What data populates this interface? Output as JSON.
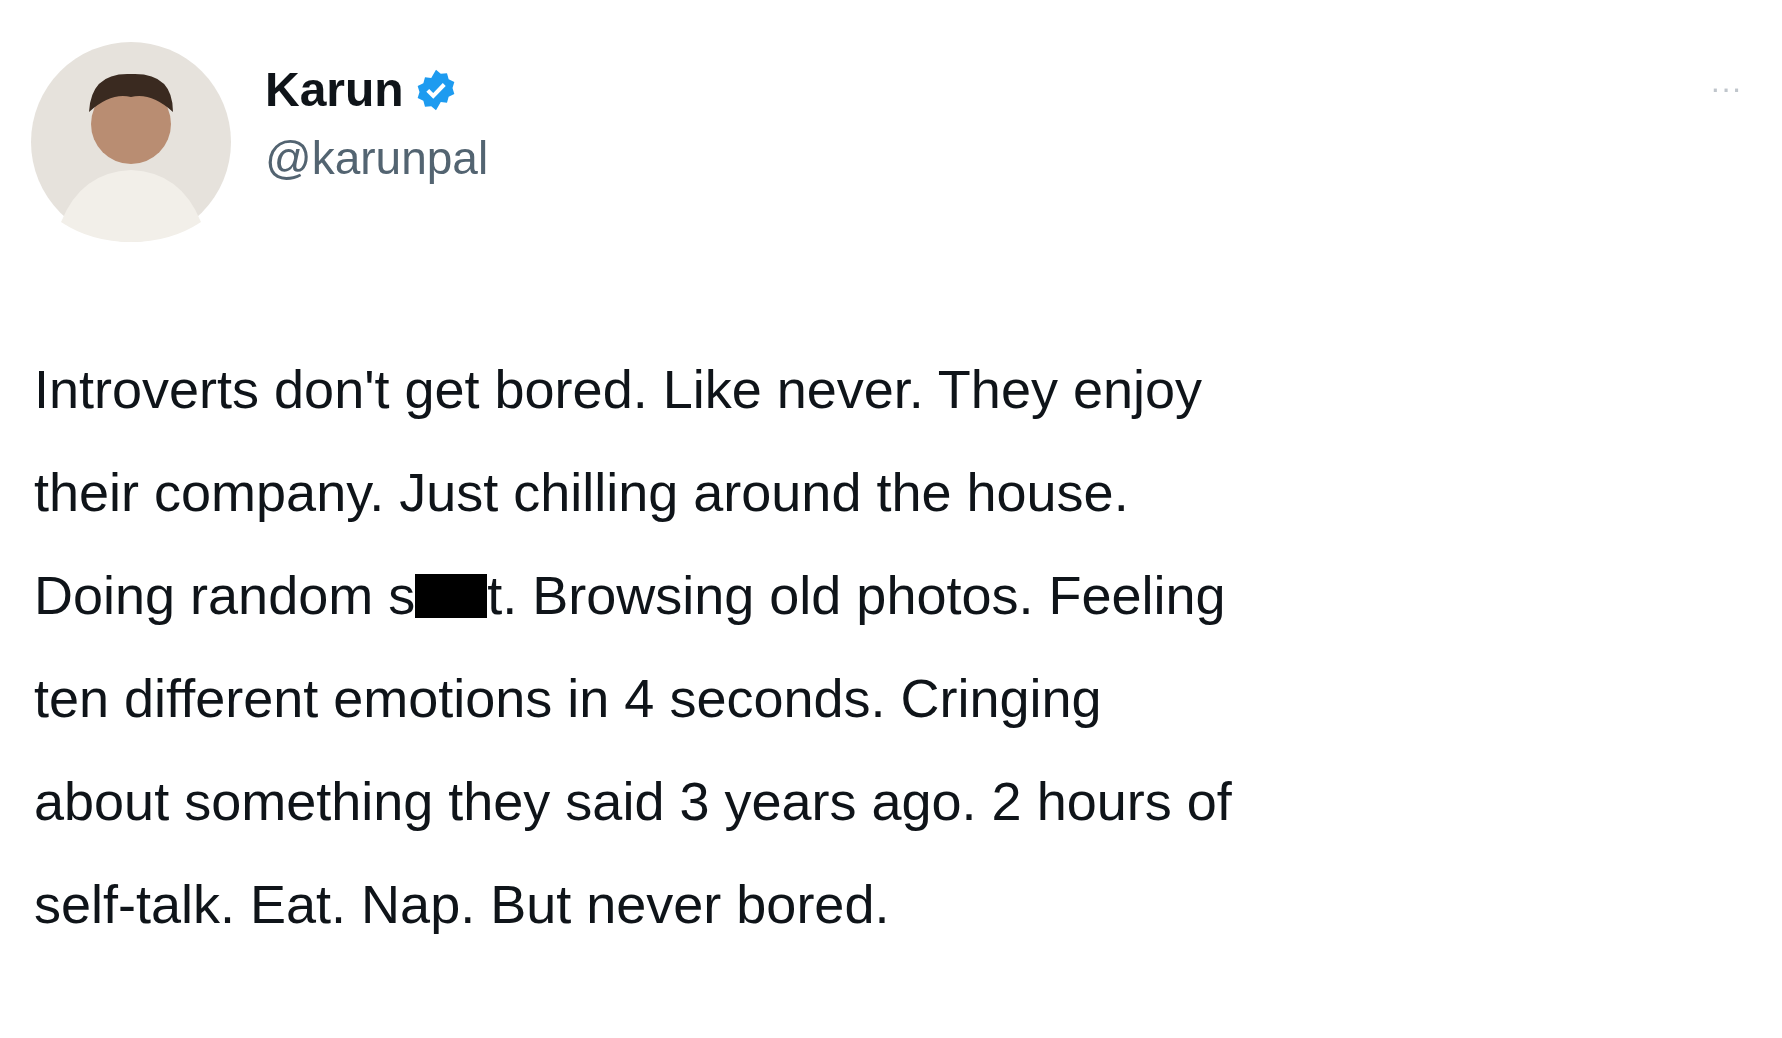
{
  "author": {
    "name": "Karun",
    "verified": true,
    "handle": "@karunpal"
  },
  "menu": "···",
  "body_lines": [
    {
      "text": "Introverts don't get bored. Like never. They enjoy",
      "redacted": false
    },
    {
      "text": "their company. Just chilling around the house.",
      "redacted": false
    },
    {
      "text": "Doing random s",
      "redacted": true,
      "after": "t. Browsing old photos. Feeling"
    },
    {
      "text": "ten different emotions in 4 seconds. Cringing",
      "redacted": false
    },
    {
      "text": "about something they said 3 years ago. 2 hours of",
      "redacted": false
    },
    {
      "text": "self-talk. Eat. Nap. But never bored.",
      "redacted": false
    }
  ]
}
